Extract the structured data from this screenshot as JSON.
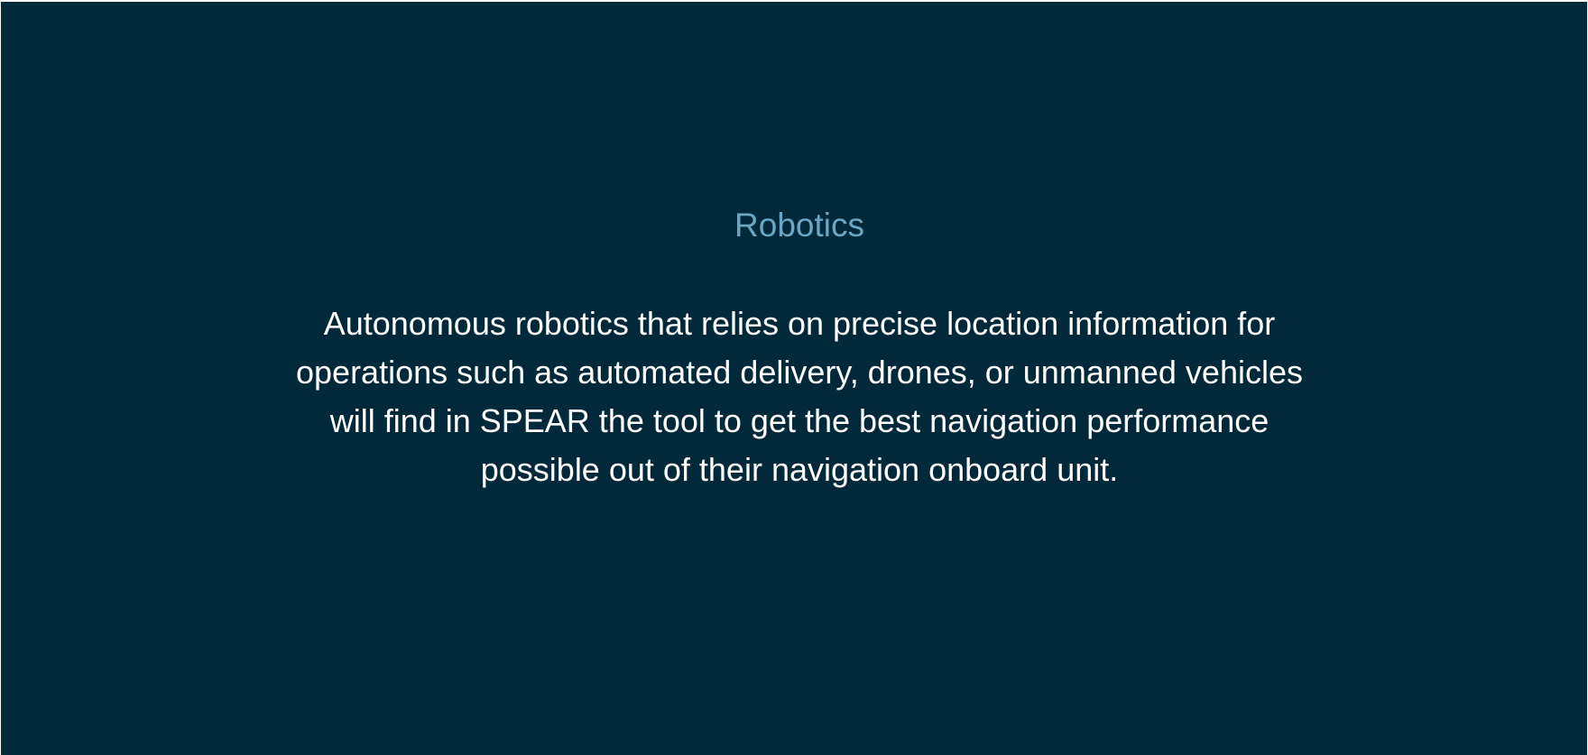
{
  "section": {
    "title": "Robotics",
    "body": "Autonomous robotics that relies on precise location information for operations such as automated delivery, drones, or unmanned vehicles will find in SPEAR the tool to get the best navigation performance possible out of their navigation onboard unit."
  },
  "colors": {
    "background": "#01293a",
    "title": "#6da6c2",
    "body_text": "#ffffff"
  }
}
